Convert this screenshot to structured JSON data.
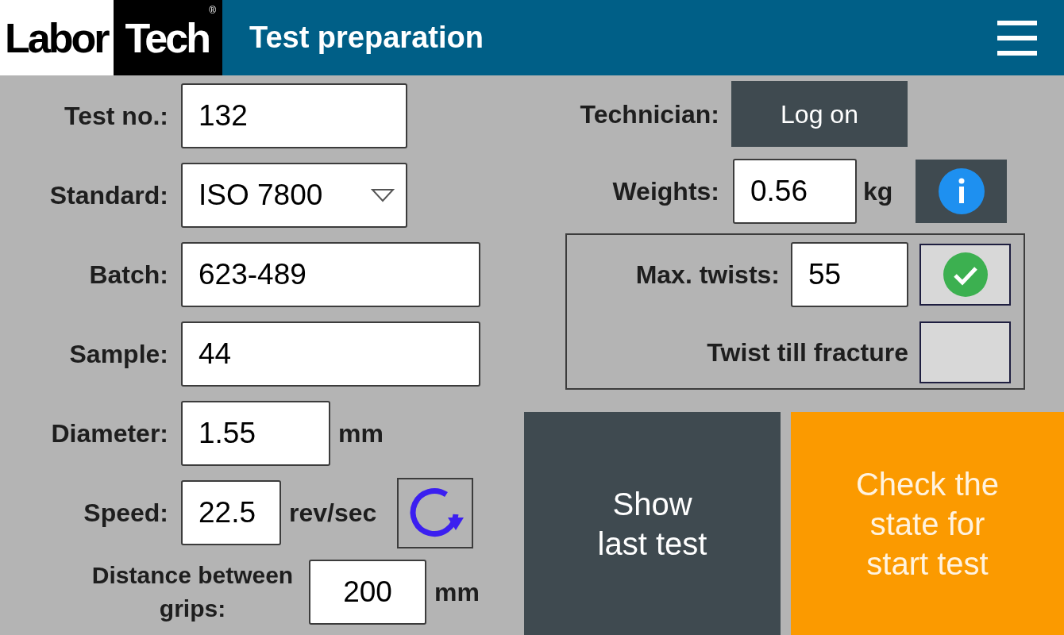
{
  "header": {
    "logo": {
      "part_1": "Labor",
      "part_2": "Tech",
      "mark": "®"
    },
    "title": "Test preparation"
  },
  "form": [
    {
      "kind": "text",
      "label": "Test no.:",
      "value": "132"
    },
    {
      "kind": "dropdown",
      "label": "Standard:",
      "value": "ISO 7800"
    },
    {
      "kind": "text",
      "label": "Batch:",
      "value": "623-489"
    },
    {
      "kind": "text",
      "label": "Sample:",
      "value": "44"
    },
    {
      "kind": "text",
      "label": "Diameter:",
      "value": "1.55",
      "unit": "mm"
    },
    {
      "kind": "refresh",
      "label": "Speed:",
      "value": "22.5",
      "unit": "rev/sec"
    },
    {
      "kind": "wide_label",
      "label": "Distance between grips:",
      "value": "200",
      "unit": "mm"
    }
  ],
  "technician": {
    "label": "Technician:",
    "button": "Log on"
  },
  "weights": {
    "label": "Weights:",
    "value": "0.56",
    "unit": "kg"
  },
  "options": [
    {
      "kind": "value",
      "label": "Max. twists:",
      "value": "55",
      "checked": true
    },
    {
      "kind": "plain",
      "label": "Twist till fracture",
      "checked": false
    }
  ],
  "actions": [
    {
      "kind": "dark",
      "label": "Show last test"
    },
    {
      "kind": "orange",
      "label": "Check the state for start test"
    }
  ]
}
